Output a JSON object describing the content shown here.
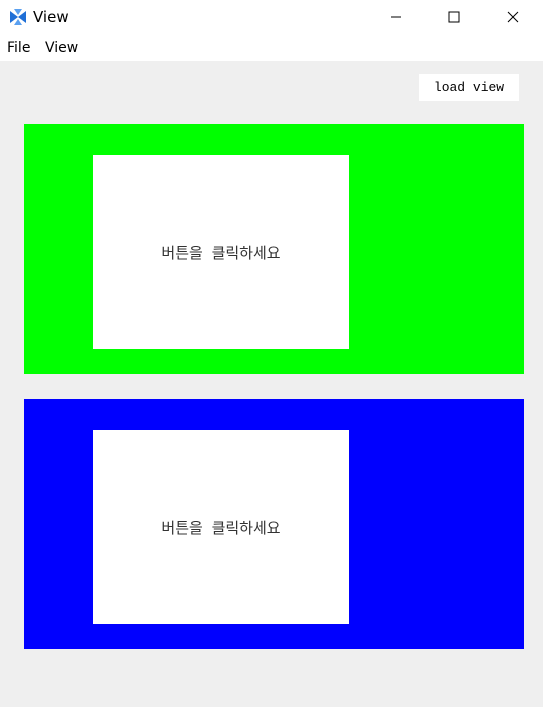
{
  "window": {
    "title": "View",
    "icon": "app-logo-icon",
    "controls": [
      "minimize-icon",
      "maximize-icon",
      "close-icon"
    ]
  },
  "menubar": {
    "items": [
      {
        "label": "File"
      },
      {
        "label": "View"
      }
    ]
  },
  "toolbar": {
    "load_button_label": "load view"
  },
  "panels": [
    {
      "color": "#00ff00",
      "label": "버튼을 클릭하세요"
    },
    {
      "color": "#0000ff",
      "label": "버튼을 클릭하세요"
    }
  ]
}
